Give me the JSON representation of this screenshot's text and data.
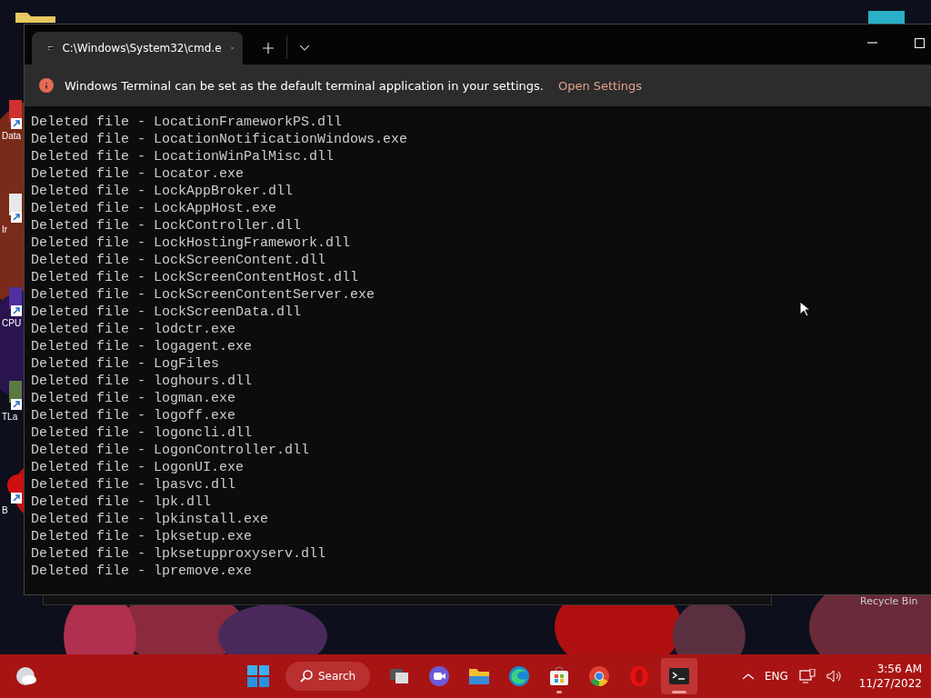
{
  "desktop_icons": [
    {
      "label": "Data",
      "kind": "red"
    },
    {
      "label": "Ir",
      "kind": "white"
    },
    {
      "label": "CPU",
      "kind": "purple"
    },
    {
      "label": "TLa",
      "kind": "green"
    },
    {
      "label": "B",
      "kind": "redcircle"
    }
  ],
  "recycle_bin": {
    "label": "Recycle Bin"
  },
  "window": {
    "tab": {
      "title": "C:\\Windows\\System32\\cmd.e",
      "selected": true
    },
    "infobar": {
      "message": "Windows Terminal can be set as the default terminal application in your settings.",
      "link": "Open Settings"
    },
    "console_lines": [
      "Deleted file - LocationFrameworkPS.dll",
      "Deleted file - LocationNotificationWindows.exe",
      "Deleted file - LocationWinPalMisc.dll",
      "Deleted file - Locator.exe",
      "Deleted file - LockAppBroker.dll",
      "Deleted file - LockAppHost.exe",
      "Deleted file - LockController.dll",
      "Deleted file - LockHostingFramework.dll",
      "Deleted file - LockScreenContent.dll",
      "Deleted file - LockScreenContentHost.dll",
      "Deleted file - LockScreenContentServer.exe",
      "Deleted file - LockScreenData.dll",
      "Deleted file - lodctr.exe",
      "Deleted file - logagent.exe",
      "Deleted file - LogFiles",
      "Deleted file - loghours.dll",
      "Deleted file - logman.exe",
      "Deleted file - logoff.exe",
      "Deleted file - logoncli.dll",
      "Deleted file - LogonController.dll",
      "Deleted file - LogonUI.exe",
      "Deleted file - lpasvc.dll",
      "Deleted file - lpk.dll",
      "Deleted file - lpkinstall.exe",
      "Deleted file - lpksetup.exe",
      "Deleted file - lpksetupproxyserv.dll",
      "Deleted file - lpremove.exe"
    ]
  },
  "taskbar": {
    "search": "Search",
    "apps": [
      {
        "kind": "taskview",
        "running": false,
        "selected": false
      },
      {
        "kind": "chat",
        "running": false,
        "selected": false
      },
      {
        "kind": "explorer",
        "running": false,
        "selected": false
      },
      {
        "kind": "edge",
        "running": false,
        "selected": false
      },
      {
        "kind": "store",
        "running": true,
        "selected": false
      },
      {
        "kind": "chrome",
        "running": false,
        "selected": false
      },
      {
        "kind": "opera",
        "running": false,
        "selected": false
      },
      {
        "kind": "terminal",
        "running": true,
        "selected": true
      }
    ],
    "language": "ENG",
    "time": "3:56 AM",
    "date": "11/27/2022"
  }
}
